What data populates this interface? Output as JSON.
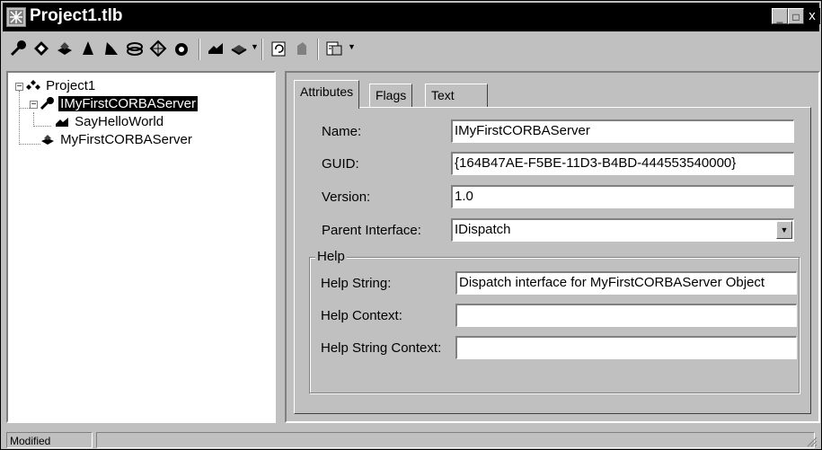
{
  "window": {
    "title": "Project1.tlb"
  },
  "titlebar_buttons": {
    "minimize": "_",
    "maximize": "□",
    "close": "x"
  },
  "toolbar": {
    "tools": [
      "interface-icon",
      "dispinterface-icon",
      "coclass-icon",
      "enum-icon",
      "alias-icon",
      "record-icon",
      "union-icon",
      "module-icon",
      "method-icon",
      "property-icon",
      "refresh-icon",
      "register-icon",
      "export-icon"
    ]
  },
  "tree": {
    "root": "Project1",
    "interface": "IMyFirstCORBAServer",
    "method": "SayHelloWorld",
    "coclass": "MyFirstCORBAServer"
  },
  "tabs": [
    "Attributes",
    "Flags",
    "Text"
  ],
  "attributes": {
    "name_label": "Name:",
    "name_value": "IMyFirstCORBAServer",
    "guid_label": "GUID:",
    "guid_value": "{164B47AE-F5BE-11D3-B4BD-444553540000}",
    "version_label": "Version:",
    "version_value": "1.0",
    "parent_label": "Parent Interface:",
    "parent_value": "IDispatch"
  },
  "help": {
    "group_title": "Help",
    "string_label": "Help String:",
    "string_value": "Dispatch interface for MyFirstCORBAServer Object",
    "context_label": "Help Context:",
    "context_value": "",
    "string_context_label": "Help String Context:",
    "string_context_value": ""
  },
  "status": {
    "text": "Modified"
  }
}
